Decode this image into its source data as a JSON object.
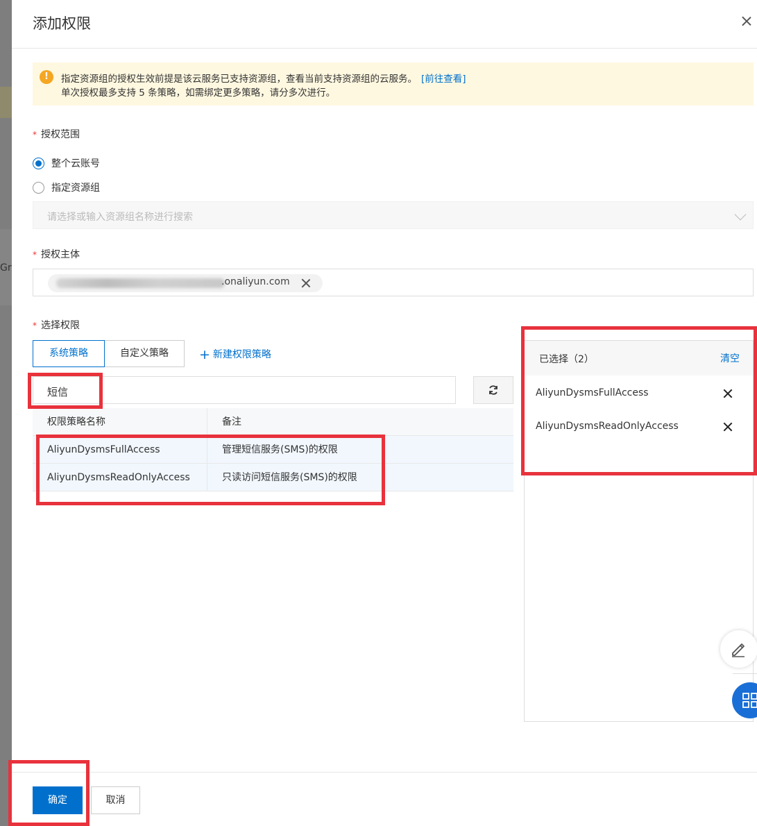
{
  "background": {
    "partial_text": "Gr"
  },
  "drawer": {
    "title": "添加权限"
  },
  "notice": {
    "icon": "!",
    "line1": "指定资源组的授权生效前提是该云服务已支持资源组，查看当前支持资源组的云服务。",
    "link": "[前往查看]",
    "line2": "单次授权最多支持 5 条策略，如需绑定更多策略，请分多次进行。"
  },
  "scope": {
    "required_mark": "*",
    "label": "授权范围",
    "options": [
      {
        "label": "整个云账号",
        "checked": true
      },
      {
        "label": "指定资源组",
        "checked": false
      }
    ],
    "resource_group_placeholder": "请选择或输入资源组名称进行搜索"
  },
  "principal": {
    "required_mark": "*",
    "label": "授权主体",
    "tag_visible_text": ".onaliyun.com"
  },
  "permissions": {
    "required_mark": "*",
    "label": "选择权限",
    "tabs": [
      {
        "label": "系统策略",
        "active": true
      },
      {
        "label": "自定义策略",
        "active": false
      }
    ],
    "new_policy_label": "新建权限策略",
    "search_value": "短信",
    "table": {
      "columns": [
        "权限策略名称",
        "备注"
      ],
      "rows": [
        {
          "name": "AliyunDysmsFullAccess",
          "note": "管理短信服务(SMS)的权限"
        },
        {
          "name": "AliyunDysmsReadOnlyAccess",
          "note": "只读访问短信服务(SMS)的权限"
        }
      ]
    }
  },
  "selected": {
    "title": "已选择（2）",
    "clear_label": "清空",
    "items": [
      "AliyunDysmsFullAccess",
      "AliyunDysmsReadOnlyAccess"
    ]
  },
  "footer": {
    "confirm_label": "确定",
    "cancel_label": "取消"
  },
  "colors": {
    "primary": "#0070cc",
    "highlight_box": "#e8323c",
    "notice_bg": "#fff8e0",
    "warning_icon": "#f5a623"
  }
}
